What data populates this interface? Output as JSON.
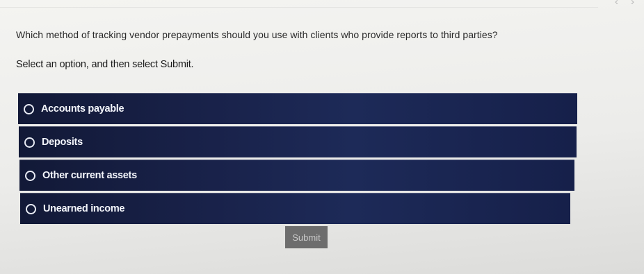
{
  "nav": {
    "prev_glyph": "‹",
    "next_glyph": "›"
  },
  "question": {
    "text": "Which method of tracking vendor prepayments should you use with clients who provide reports to third parties?",
    "instruction": "Select an option, and then select Submit."
  },
  "options": [
    {
      "label": "Accounts payable",
      "selected": false
    },
    {
      "label": "Deposits",
      "selected": false
    },
    {
      "label": "Other current assets",
      "selected": false
    },
    {
      "label": "Unearned income",
      "selected": false
    }
  ],
  "submit": {
    "label": "Submit"
  },
  "colors": {
    "option_background": "#19224a",
    "option_text": "#f3f5fb",
    "submit_background": "#6d6d6d",
    "page_background": "#ececea"
  }
}
